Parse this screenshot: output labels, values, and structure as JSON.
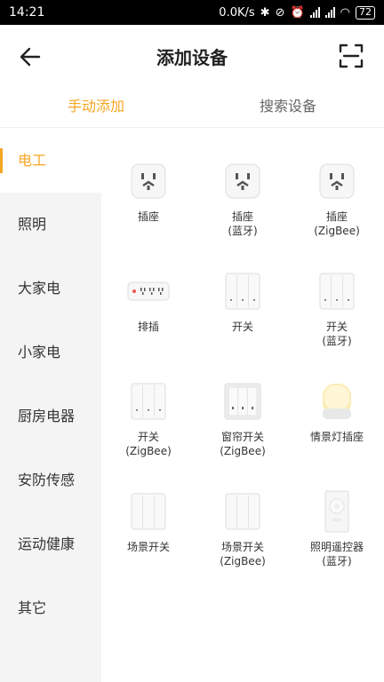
{
  "status": {
    "time": "14:21",
    "speed": "0.0K/s",
    "battery": "72"
  },
  "header": {
    "title": "添加设备"
  },
  "tabs": [
    {
      "label": "手动添加"
    },
    {
      "label": "搜索设备"
    }
  ],
  "sidebar": {
    "items": [
      {
        "label": "电工"
      },
      {
        "label": "照明"
      },
      {
        "label": "大家电"
      },
      {
        "label": "小家电"
      },
      {
        "label": "厨房电器"
      },
      {
        "label": "安防传感"
      },
      {
        "label": "运动健康"
      },
      {
        "label": "其它"
      }
    ]
  },
  "devices": [
    {
      "name": "插座",
      "sub": "",
      "icon": "socket-icon"
    },
    {
      "name": "插座",
      "sub": "(蓝牙)",
      "icon": "socket-icon"
    },
    {
      "name": "插座",
      "sub": "(ZigBee)",
      "icon": "socket-icon"
    },
    {
      "name": "排插",
      "sub": "",
      "icon": "power-strip-icon"
    },
    {
      "name": "开关",
      "sub": "",
      "icon": "switch-icon"
    },
    {
      "name": "开关",
      "sub": "(蓝牙)",
      "icon": "switch-icon"
    },
    {
      "name": "开关",
      "sub": "(ZigBee)",
      "icon": "switch-icon"
    },
    {
      "name": "窗帘开关",
      "sub": "(ZigBee)",
      "icon": "curtain-switch-icon"
    },
    {
      "name": "情景灯插座",
      "sub": "",
      "icon": "scene-lamp-icon"
    },
    {
      "name": "场景开关",
      "sub": "",
      "icon": "scene-switch-icon"
    },
    {
      "name": "场景开关",
      "sub": "(ZigBee)",
      "icon": "scene-switch-icon"
    },
    {
      "name": "照明遥控器",
      "sub": "(蓝牙)",
      "icon": "remote-icon"
    }
  ],
  "colors": {
    "accent": "#f5a623",
    "sidebar_bg": "#f4f4f4"
  }
}
